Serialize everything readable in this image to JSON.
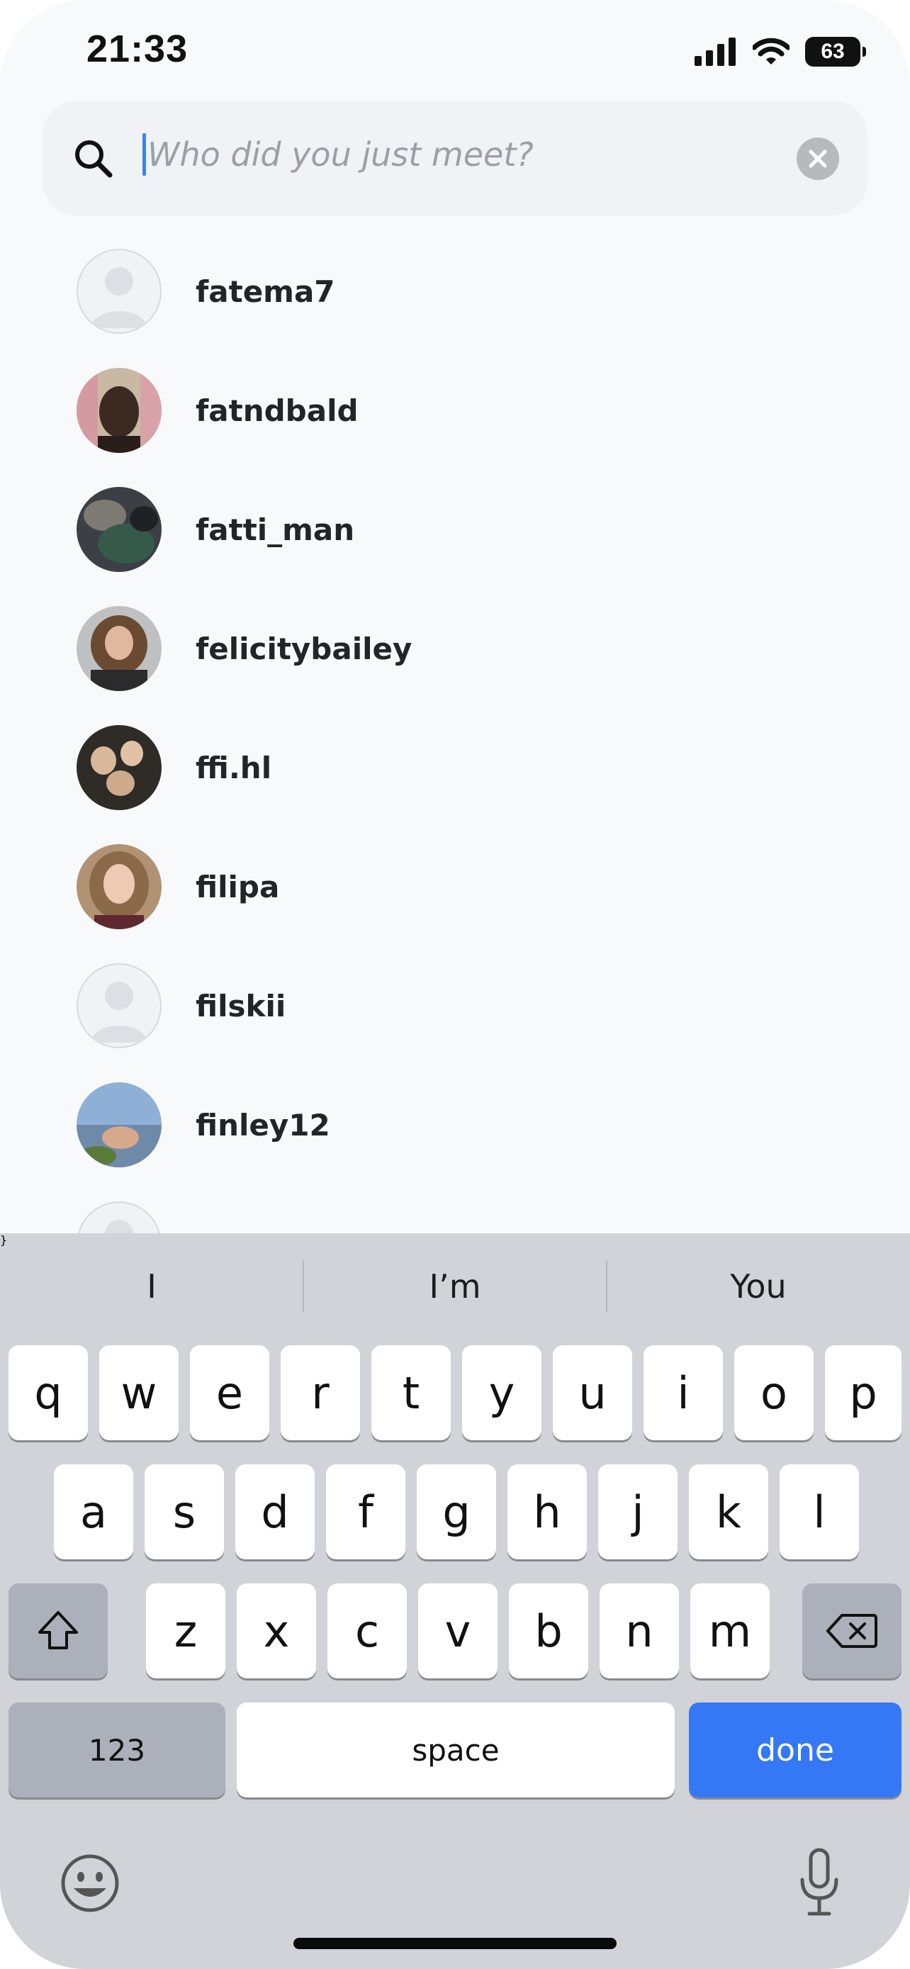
{
  "status_bar": {
    "time": "21:33",
    "battery_level": "63",
    "icons": [
      "cellular-signal-icon",
      "wifi-icon",
      "battery-icon"
    ]
  },
  "search": {
    "value": "",
    "placeholder": "Who did you just meet?",
    "search_icon": "search-icon",
    "clear_icon": "clear-icon"
  },
  "results": [
    {
      "username": "fatema7",
      "avatar": "default"
    },
    {
      "username": "fatndbald",
      "avatar": "photo"
    },
    {
      "username": "fatti_man",
      "avatar": "photo"
    },
    {
      "username": "felicitybailey",
      "avatar": "photo"
    },
    {
      "username": "ffi.hl",
      "avatar": "photo"
    },
    {
      "username": "filipa",
      "avatar": "photo"
    },
    {
      "username": "filskii",
      "avatar": "default"
    },
    {
      "username": "finley12",
      "avatar": "photo"
    },
    {
      "username": "",
      "avatar": "default"
    }
  ],
  "keyboard": {
    "suggestions": [
      "I",
      "I’m",
      "You"
    ],
    "row1": [
      "q",
      "w",
      "e",
      "r",
      "t",
      "y",
      "u",
      "i",
      "o",
      "p"
    ],
    "row2": [
      "a",
      "s",
      "d",
      "f",
      "g",
      "h",
      "j",
      "k",
      "l"
    ],
    "row3": [
      "z",
      "x",
      "c",
      "v",
      "b",
      "n",
      "m"
    ],
    "numbers_label": "123",
    "space_label": "space",
    "done_label": "done",
    "icons": [
      "shift-icon",
      "backspace-icon",
      "emoji-icon",
      "microphone-icon"
    ]
  },
  "colors": {
    "accent": "#3478f6",
    "caret": "#3b82f6",
    "background": "#f8f9fa",
    "keyboard_bg": "#d1d3d9"
  }
}
